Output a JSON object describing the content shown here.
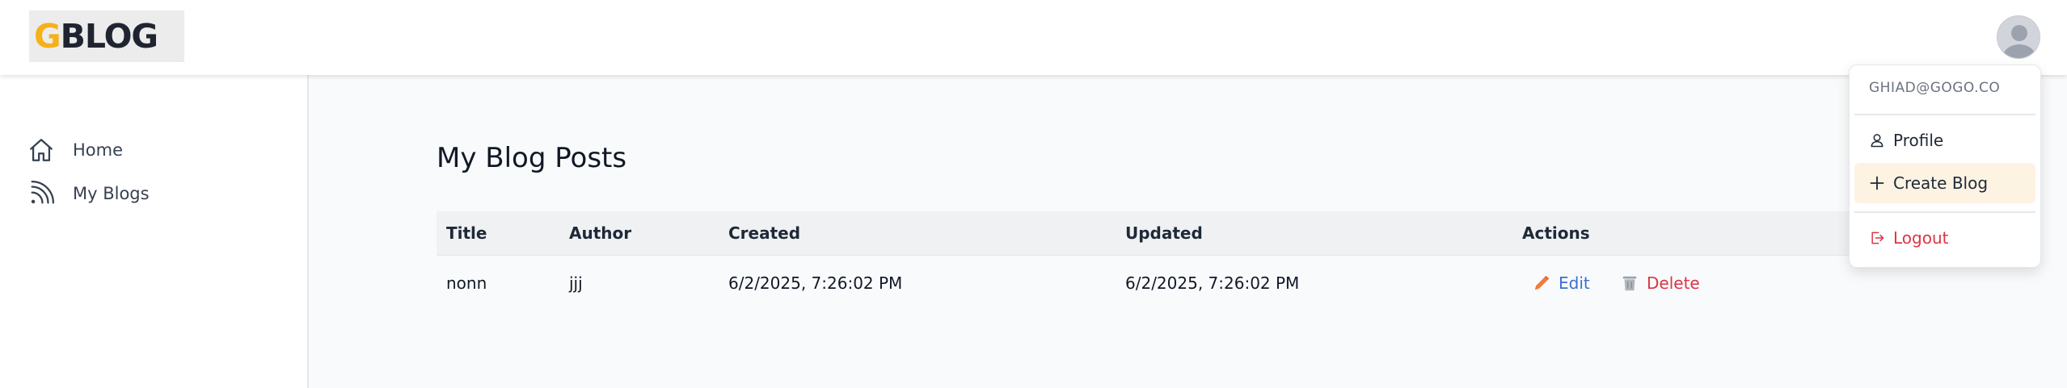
{
  "brand": {
    "logo_first": "G",
    "logo_rest": "BLOG"
  },
  "user": {
    "email": "GHIAD@GOGO.CO",
    "avatar_icon": "user-avatar-icon"
  },
  "sidebar": {
    "items": [
      {
        "label": "Home",
        "icon": "home-icon"
      },
      {
        "label": "My Blogs",
        "icon": "rss-icon"
      }
    ]
  },
  "main": {
    "title": "My Blog Posts",
    "table": {
      "headers": [
        "Title",
        "Author",
        "Created",
        "Updated",
        "Actions"
      ],
      "rows": [
        {
          "title": "nonn",
          "author": "jjj",
          "created": "6/2/2025, 7:26:02 PM",
          "updated": "6/2/2025, 7:26:02 PM",
          "edit_label": "Edit",
          "delete_label": "Delete"
        }
      ]
    }
  },
  "dropdown": {
    "items": [
      {
        "label": "Profile",
        "icon": "user-icon"
      },
      {
        "label": "Create Blog",
        "icon": "plus-icon"
      },
      {
        "label": "Logout",
        "icon": "logout-icon"
      }
    ]
  },
  "colors": {
    "brand_accent": "#f5b118",
    "edit": "#3b6fd4",
    "delete": "#dc3545",
    "active_menu_bg": "#fdf3e3"
  }
}
